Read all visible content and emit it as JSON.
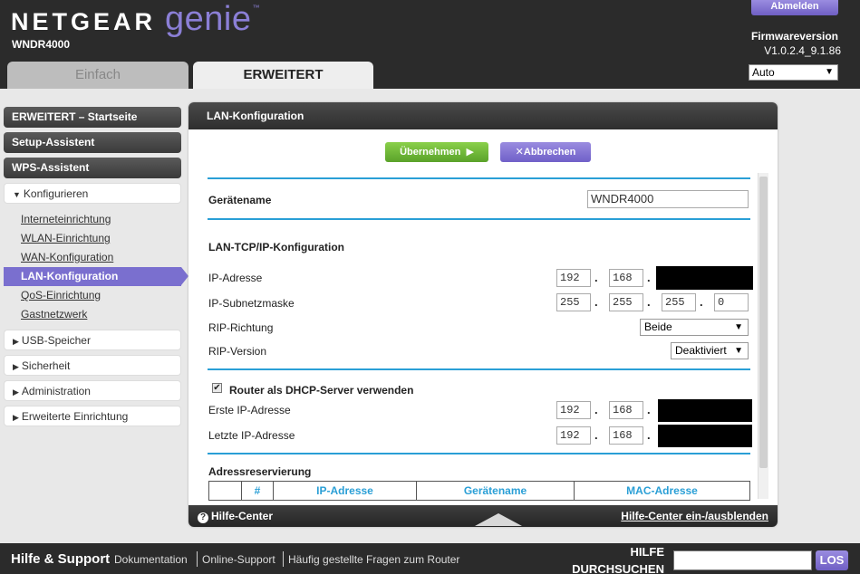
{
  "header": {
    "brand_main": "NETGEAR",
    "brand_sub": "genie",
    "brand_tm": "™",
    "model": "WNDR4000",
    "logout_label": "Abmelden",
    "firmware_label": "Firmwareversion",
    "firmware_version": "V1.0.2.4_9.1.86",
    "language": "Auto",
    "tabs": [
      {
        "label": "Einfach",
        "active": false
      },
      {
        "label": "ERWEITERT",
        "active": true
      }
    ]
  },
  "sidebar": {
    "top_items": [
      {
        "label": "ERWEITERT – Startseite"
      },
      {
        "label": "Setup-Assistent"
      },
      {
        "label": "WPS-Assistent"
      }
    ],
    "configure": {
      "label": "Konfigurieren",
      "items": [
        {
          "label": "Interneteinrichtung"
        },
        {
          "label": "WLAN-Einrichtung"
        },
        {
          "label": "WAN-Konfiguration"
        },
        {
          "label": "LAN-Konfiguration",
          "active": true
        },
        {
          "label": "QoS-Einrichtung"
        },
        {
          "label": "Gastnetzwerk"
        }
      ]
    },
    "sections": [
      {
        "label": "USB-Speicher"
      },
      {
        "label": "Sicherheit"
      },
      {
        "label": "Administration"
      },
      {
        "label": "Erweiterte Einrichtung"
      }
    ]
  },
  "panel": {
    "title": "LAN-Konfiguration",
    "apply_label": "Übernehmen",
    "apply_icon": "play-arrow-icon",
    "cancel_label": "Abbrechen",
    "cancel_icon": "x-icon",
    "device_name_label": "Gerätename",
    "device_name_value": "WNDR4000",
    "lan_section_title": "LAN-TCP/IP-Konfiguration",
    "ip_label": "IP-Adresse",
    "ip": [
      "192",
      "168"
    ],
    "subnet_label": "IP-Subnetzmaske",
    "subnet": [
      "255",
      "255",
      "255",
      "0"
    ],
    "rip_direction_label": "RIP-Richtung",
    "rip_direction_value": "Beide",
    "rip_version_label": "RIP-Version",
    "rip_version_value": "Deaktiviert",
    "dhcp_checked": true,
    "dhcp_label": "Router als DHCP-Server verwenden",
    "first_ip_label": "Erste IP-Adresse",
    "first_ip": [
      "192",
      "168"
    ],
    "last_ip_label": "Letzte IP-Adresse",
    "last_ip": [
      "192",
      "168"
    ],
    "reservation_title": "Adressreservierung",
    "reservation_columns": [
      "",
      "#",
      "IP-Adresse",
      "Gerätename",
      "MAC-Adresse"
    ],
    "footer_help": "Hilfe-Center",
    "footer_toggle": "Hilfe-Center ein-/ausblenden"
  },
  "bottom": {
    "title": "Hilfe & Support",
    "links": [
      "Dokumentation",
      "Online-Support",
      "Häufig gestellte Fragen zum Router"
    ],
    "search_label_line1": "HILFE",
    "search_label_line2": "DURCHSUCHEN",
    "search_button": "LOS"
  },
  "colors": {
    "accent_purple": "#7a6fcf",
    "accent_green": "#6cb83a",
    "rule_blue": "#2a9fd6",
    "header_dark": "#2b2b2b"
  }
}
